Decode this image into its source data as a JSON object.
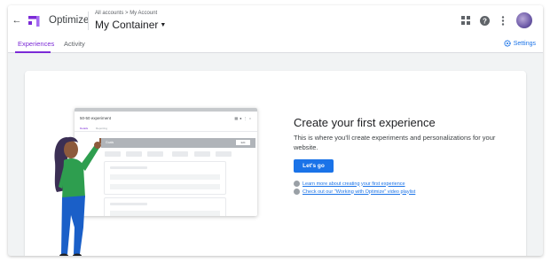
{
  "header": {
    "back_icon": "arrow-back-icon",
    "app_name": "Optimize",
    "breadcrumb": "All accounts > My Account",
    "container_name": "My Container",
    "icons": [
      "apps-grid-icon",
      "help-icon",
      "more-vert-icon",
      "avatar"
    ]
  },
  "tabs": [
    {
      "label": "Experiences",
      "active": true
    },
    {
      "label": "Activity",
      "active": false
    }
  ],
  "settings_label": "Settings",
  "mockup": {
    "title": "50-50 experiment",
    "tab1": "Details",
    "tab2": "Reporting",
    "bar_label": "Goals",
    "bar_button": "Edit"
  },
  "content": {
    "headline": "Create your first experience",
    "description": "This is where you'll create experiments and personalizations for your website.",
    "button_label": "Let's go",
    "links": [
      " Learn more about creating your first experience",
      " Check out our \"Working with Optimize\" video playlist"
    ]
  },
  "colors": {
    "accent": "#7b2ad6",
    "primary": "#1a73e8",
    "background": "#f1f3f4"
  }
}
